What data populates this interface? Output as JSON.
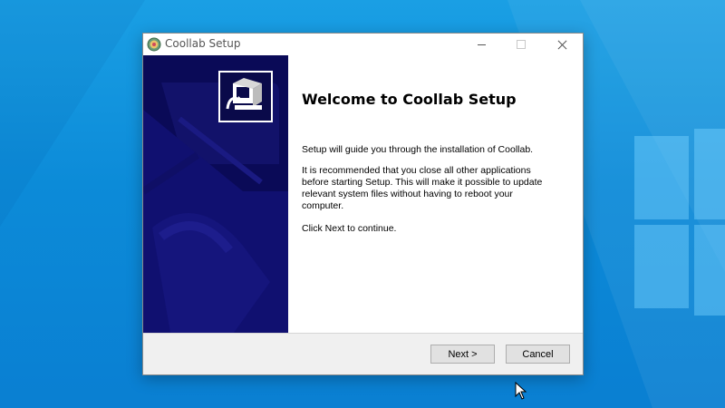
{
  "window": {
    "title": "Coollab Setup",
    "icon": "coollab-app-icon",
    "controls": [
      "minimize-icon",
      "maximize-icon",
      "close-icon"
    ]
  },
  "banner": {
    "icon": "installer-computer-icon"
  },
  "main": {
    "heading": "Welcome to Coollab Setup",
    "paragraph_1": "Setup will guide you through the installation of Coollab.",
    "paragraph_2_lines": [
      "It is recommended that you close all other applications",
      "before starting Setup. This will make it possible to update",
      "relevant system files without having to reboot your",
      "computer."
    ],
    "paragraph_3": "Click Next to continue."
  },
  "footer": {
    "next_label": "Next >",
    "cancel_label": "Cancel"
  },
  "colors": {
    "desktop_blue": "#0c8bd8",
    "banner_navy": "#0a0a57",
    "window_bg": "#f0f0f0"
  }
}
